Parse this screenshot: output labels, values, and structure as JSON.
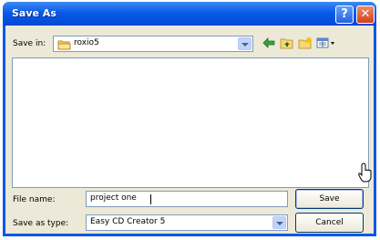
{
  "window": {
    "title": "Save As",
    "help_glyph": "?",
    "close_glyph": "✕"
  },
  "save_in": {
    "label": "Save in:",
    "value": "roxio5"
  },
  "toolbar": {
    "icons": [
      "back-arrow-icon",
      "up-folder-icon",
      "new-folder-icon",
      "view-menu-icon"
    ]
  },
  "file_name": {
    "label": "File name:",
    "value": "project one"
  },
  "save_as_type": {
    "label": "Save as type:",
    "value": "Easy CD Creator 5"
  },
  "buttons": {
    "save": "Save",
    "cancel": "Cancel"
  },
  "colors": {
    "titlebar": "#0a57e6",
    "face": "#ece9d8",
    "field_border": "#7f9db9"
  }
}
